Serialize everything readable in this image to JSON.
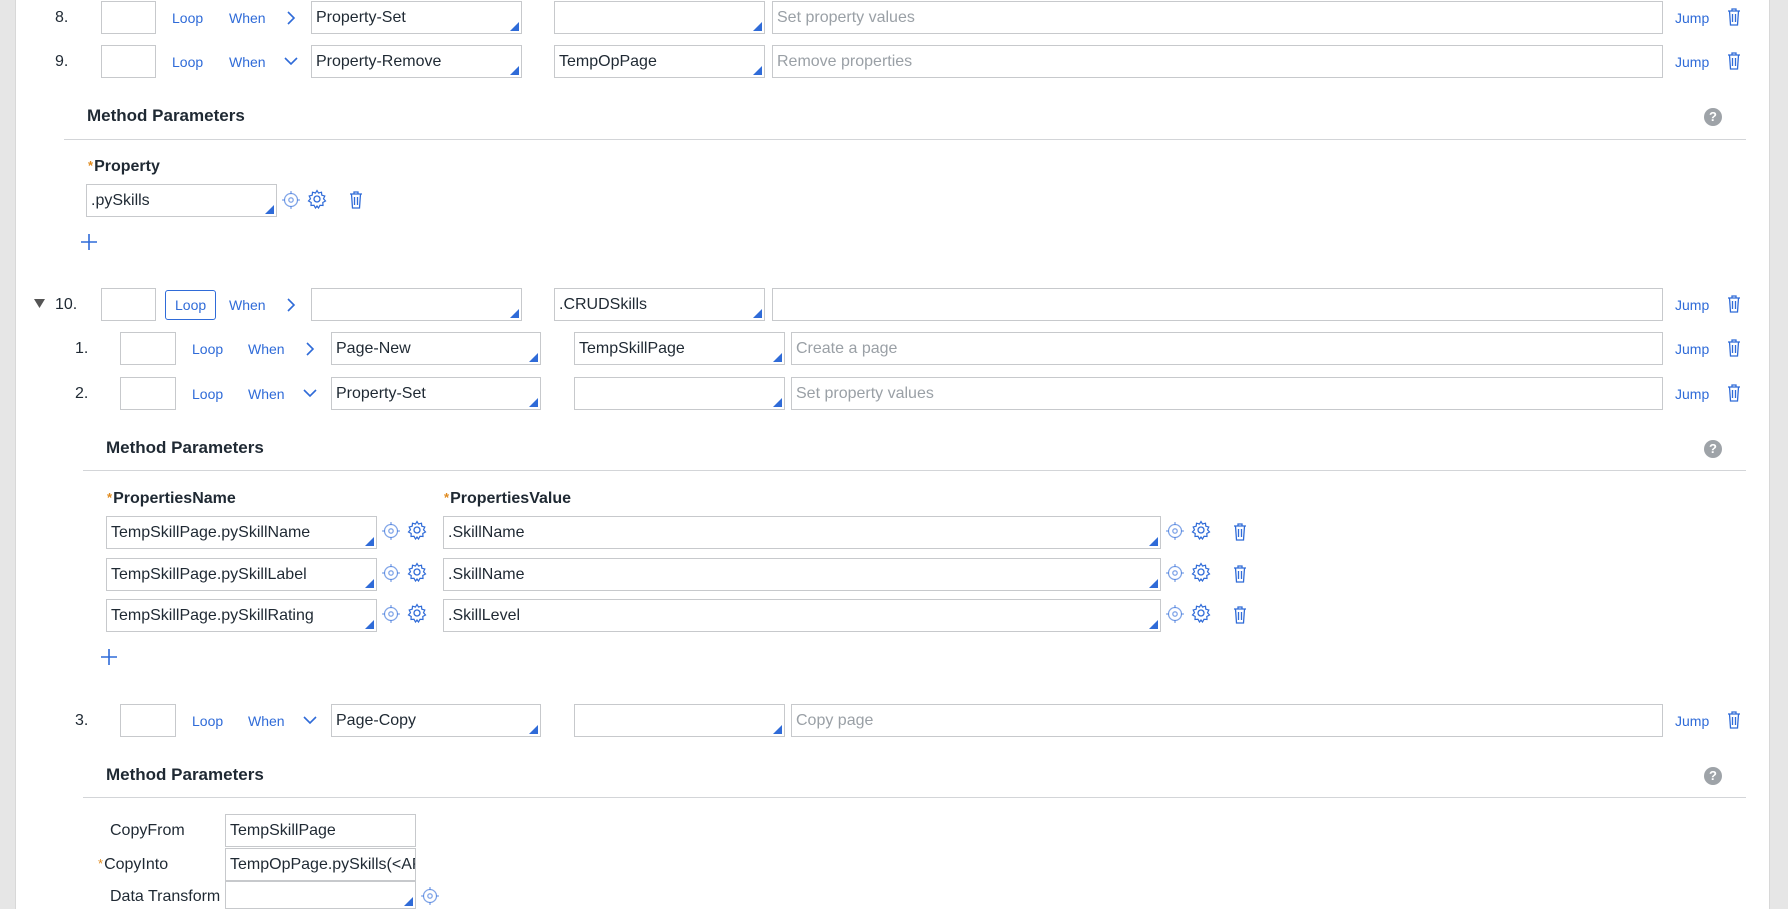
{
  "links": {
    "loop": "Loop",
    "when": "When",
    "jump": "Jump"
  },
  "steps": {
    "s8": {
      "num": "8.",
      "method": "Property-Set",
      "step_page": "",
      "description_placeholder": "Set property values"
    },
    "s9": {
      "num": "9.",
      "method": "Property-Remove",
      "step_page": "TempOpPage",
      "description_placeholder": "Remove properties",
      "params": {
        "title": "Method Parameters",
        "property_label": "Property",
        "property_value": ".pySkills"
      }
    },
    "s10": {
      "num": "10.",
      "method": "",
      "step_page": ".CRUDSkills",
      "description": ""
    },
    "s10_1": {
      "num": "1.",
      "method": "Page-New",
      "step_page": "TempSkillPage",
      "description_placeholder": "Create a page"
    },
    "s10_2": {
      "num": "2.",
      "method": "Property-Set",
      "step_page": "",
      "description_placeholder": "Set property values",
      "params": {
        "title": "Method Parameters",
        "name_header": "PropertiesName",
        "value_header": "PropertiesValue",
        "rows": [
          {
            "name": "TempSkillPage.pySkillName",
            "value": ".SkillName"
          },
          {
            "name": "TempSkillPage.pySkillLabel",
            "value": ".SkillName"
          },
          {
            "name": "TempSkillPage.pySkillRating",
            "value": ".SkillLevel"
          }
        ]
      }
    },
    "s10_3": {
      "num": "3.",
      "method": "Page-Copy",
      "step_page": "",
      "description_placeholder": "Copy page",
      "params": {
        "title": "Method Parameters",
        "copy_from_label": "CopyFrom",
        "copy_from_value": "TempSkillPage",
        "copy_into_label": "CopyInto",
        "copy_into_value": "TempOpPage.pySkills(<APPEND>)",
        "data_transform_label": "Data Transform",
        "data_transform_value": ""
      }
    }
  },
  "colors": {
    "accent": "#2f6bd8",
    "required": "#e08a1e",
    "border": "#c7c9cc"
  },
  "icons": [
    "chevron-right-icon",
    "chevron-down-icon",
    "trash-icon",
    "crosshair-icon",
    "gear-icon",
    "help-icon",
    "plus-icon",
    "collapse-triangle-icon"
  ]
}
